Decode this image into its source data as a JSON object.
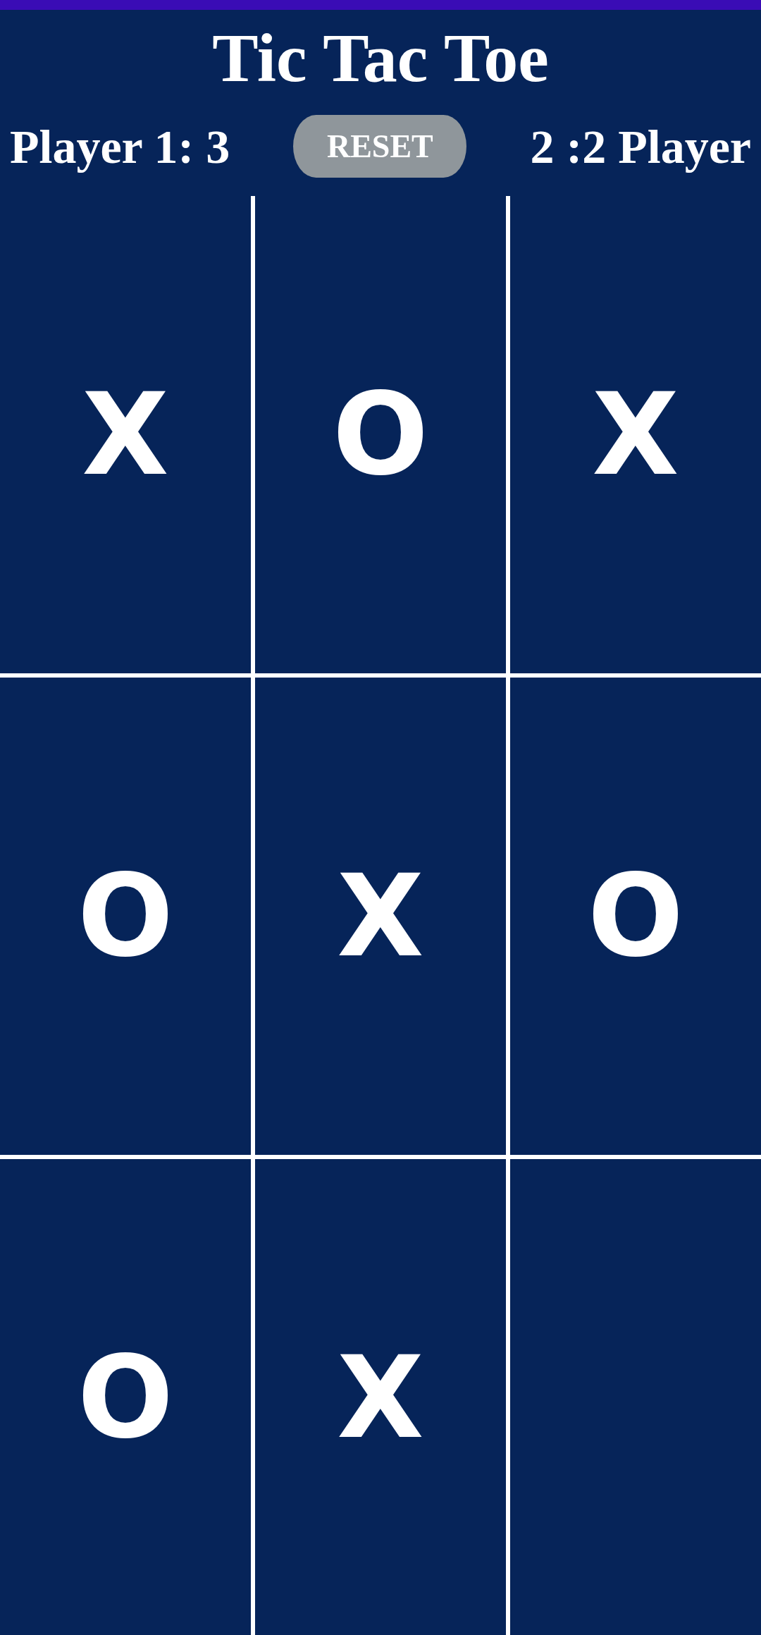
{
  "title": "Tic Tac Toe",
  "scoreboard": {
    "player_1": "Player 1: 3",
    "reset_button": "RESET",
    "player_2": "2 :2 Player"
  },
  "board": {
    "rows": [
      [
        "X",
        "O",
        "X"
      ],
      [
        "O",
        "X",
        "O"
      ],
      [
        "O",
        "X",
        null
      ]
    ]
  }
}
